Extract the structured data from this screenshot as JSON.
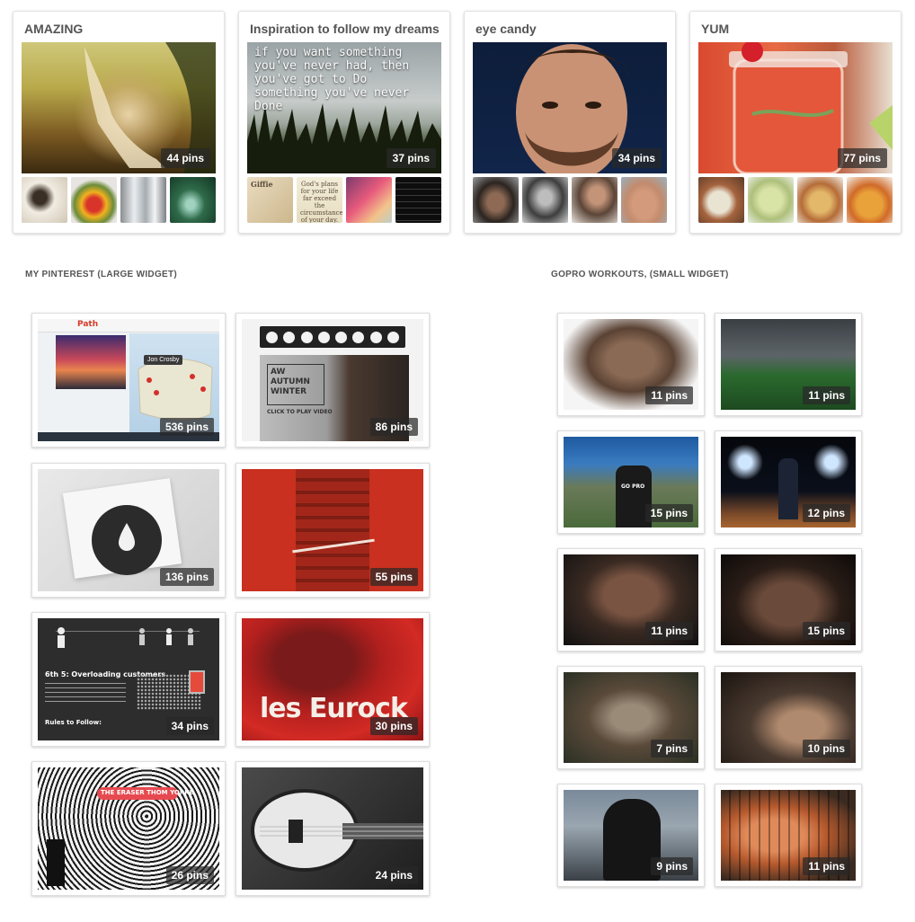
{
  "boards": [
    {
      "title": "AMAZING",
      "pins": "44 pins"
    },
    {
      "title": "Inspiration to follow my dreams",
      "pins": "37 pins",
      "quote": "if you want something you've never had, then you've got to Do something you've never Done",
      "thumb_text_1": "Giffie",
      "thumb_text_2": "God's plans for your life far exceed the circumstances of your day."
    },
    {
      "title": "eye candy",
      "pins": "34 pins"
    },
    {
      "title": "YUM",
      "pins": "77 pins"
    }
  ],
  "large_widget": {
    "heading": "MY PINTEREST (LARGE WIDGET)",
    "tiles": [
      {
        "pins": "536 pins",
        "label": "Path",
        "sub": "Jon Crosby"
      },
      {
        "pins": "86 pins",
        "label": "AW AUTUMN WINTER",
        "sub": "CLICK TO PLAY VIDEO"
      },
      {
        "pins": "136 pins"
      },
      {
        "pins": "55 pins"
      },
      {
        "pins": "34 pins",
        "label": "6th 5: Overloading customers",
        "sub": "Rules to Follow:"
      },
      {
        "pins": "30 pins",
        "label": "les Eurock"
      },
      {
        "pins": "26 pins",
        "label": "THE ERASER  THOM YORKE"
      },
      {
        "pins": "24 pins"
      }
    ]
  },
  "small_widget": {
    "heading": "GOPRO WORKOUTS, (SMALL WIDGET)",
    "tiles": [
      {
        "pins": "11 pins"
      },
      {
        "pins": "11 pins"
      },
      {
        "pins": "15 pins",
        "label": "GO PRO"
      },
      {
        "pins": "12 pins"
      },
      {
        "pins": "11 pins"
      },
      {
        "pins": "15 pins"
      },
      {
        "pins": "7 pins"
      },
      {
        "pins": "10 pins"
      },
      {
        "pins": "9 pins"
      },
      {
        "pins": "11 pins"
      }
    ]
  }
}
